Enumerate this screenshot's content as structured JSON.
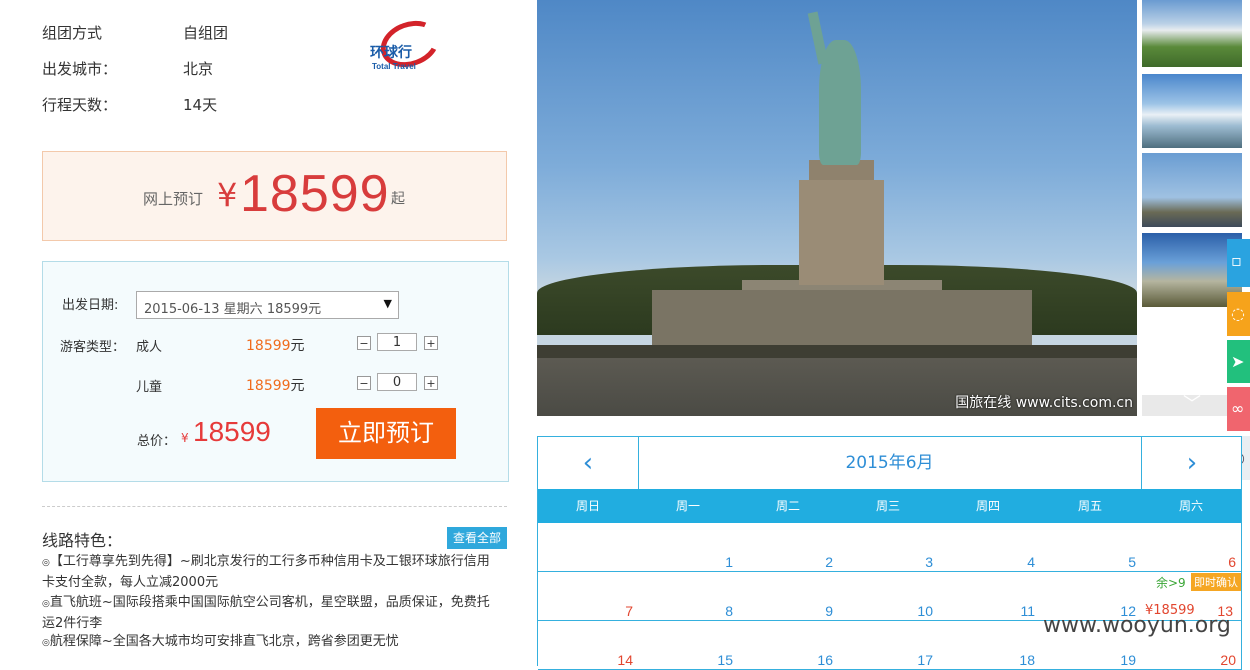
{
  "info_rows": [
    {
      "label": "组团方式",
      "value": "自组团"
    },
    {
      "label": "出发城市：",
      "value": "北京"
    },
    {
      "label": "行程天数：",
      "value": "14天"
    }
  ],
  "logo": {
    "cn": "环球行",
    "en": "Total Travel"
  },
  "price_box": {
    "label": "网上预订",
    "currency": "¥",
    "price": "18599",
    "suffix": "起"
  },
  "booking": {
    "date_label": "出发日期:",
    "date_value": "2015-06-13 星期六 18599元",
    "traveler_type_label": "游客类型：",
    "adult_label": "成人",
    "adult_price": "18599",
    "adult_qty": "1",
    "child_label": "儿童",
    "child_price": "18599",
    "child_qty": "0",
    "yuan": "元",
    "minus": "−",
    "plus": "+",
    "total_label": "总价：",
    "total_currency": "¥",
    "total_price": "18599",
    "book_button": "立即预订"
  },
  "features": {
    "title": "线路特色：",
    "view_all": "查看全部",
    "bullet": "◎",
    "items": [
      "【工行尊享先到先得】~刷北京发行的工行多币种信用卡及工银环球旅行信用卡支付全款，每人立减2000元",
      "直飞航班~国际段搭乘中国国际航空公司客机，星空联盟，品质保证，免费托运2件行李",
      "航程保障~全国各大城市均可安排直飞北京，跨省参团更无忧"
    ]
  },
  "photo": {
    "caption": "国旅在线 www.cits.com.cn"
  },
  "calendar": {
    "title": "2015年6月",
    "prev": "‹",
    "next": "›",
    "weekdays": [
      "周日",
      "周一",
      "周二",
      "周三",
      "周四",
      "周五",
      "周六"
    ],
    "rows": [
      [
        "",
        "1",
        "2",
        "3",
        "4",
        "5",
        "6"
      ],
      [
        "7",
        "8",
        "9",
        "10",
        "11",
        "12",
        "13"
      ],
      [
        "14",
        "15",
        "16",
        "17",
        "18",
        "19",
        "20"
      ]
    ],
    "highlight": {
      "stock": "余>9",
      "badge": "即时确认",
      "price": "¥18599"
    }
  },
  "watermark": "www.wooyun.org",
  "colors": {
    "accent_blue": "#21ade0",
    "price_red": "#d83c3c",
    "book_orange": "#f35f0e"
  }
}
